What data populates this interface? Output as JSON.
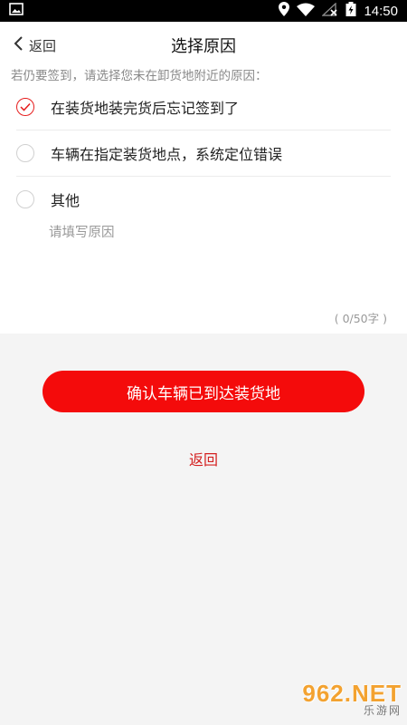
{
  "status_bar": {
    "time": "14:50",
    "icons": [
      "image-icon",
      "location-icon",
      "wifi-icon",
      "no-signal-icon",
      "battery-charging-icon"
    ]
  },
  "nav": {
    "back_label": "返回",
    "title": "选择原因"
  },
  "prompt": "若仍要签到，请选择您未在卸货地附近的原因：",
  "options": [
    {
      "label": "在装货地装完货后忘记签到了",
      "checked": true
    },
    {
      "label": "车辆在指定装货地点，系统定位错误",
      "checked": false
    },
    {
      "label": "其他",
      "checked": false
    }
  ],
  "reason": {
    "placeholder": "请填写原因",
    "value": "",
    "counter": "( 0/50字 )"
  },
  "actions": {
    "confirm_label": "确认车辆已到达装货地",
    "back_label": "返回"
  },
  "watermark": {
    "top": "962.NET",
    "bottom": "乐游网"
  },
  "colors": {
    "accent": "#f40b0b",
    "link": "#d42020",
    "background": "#f4f4f4"
  }
}
